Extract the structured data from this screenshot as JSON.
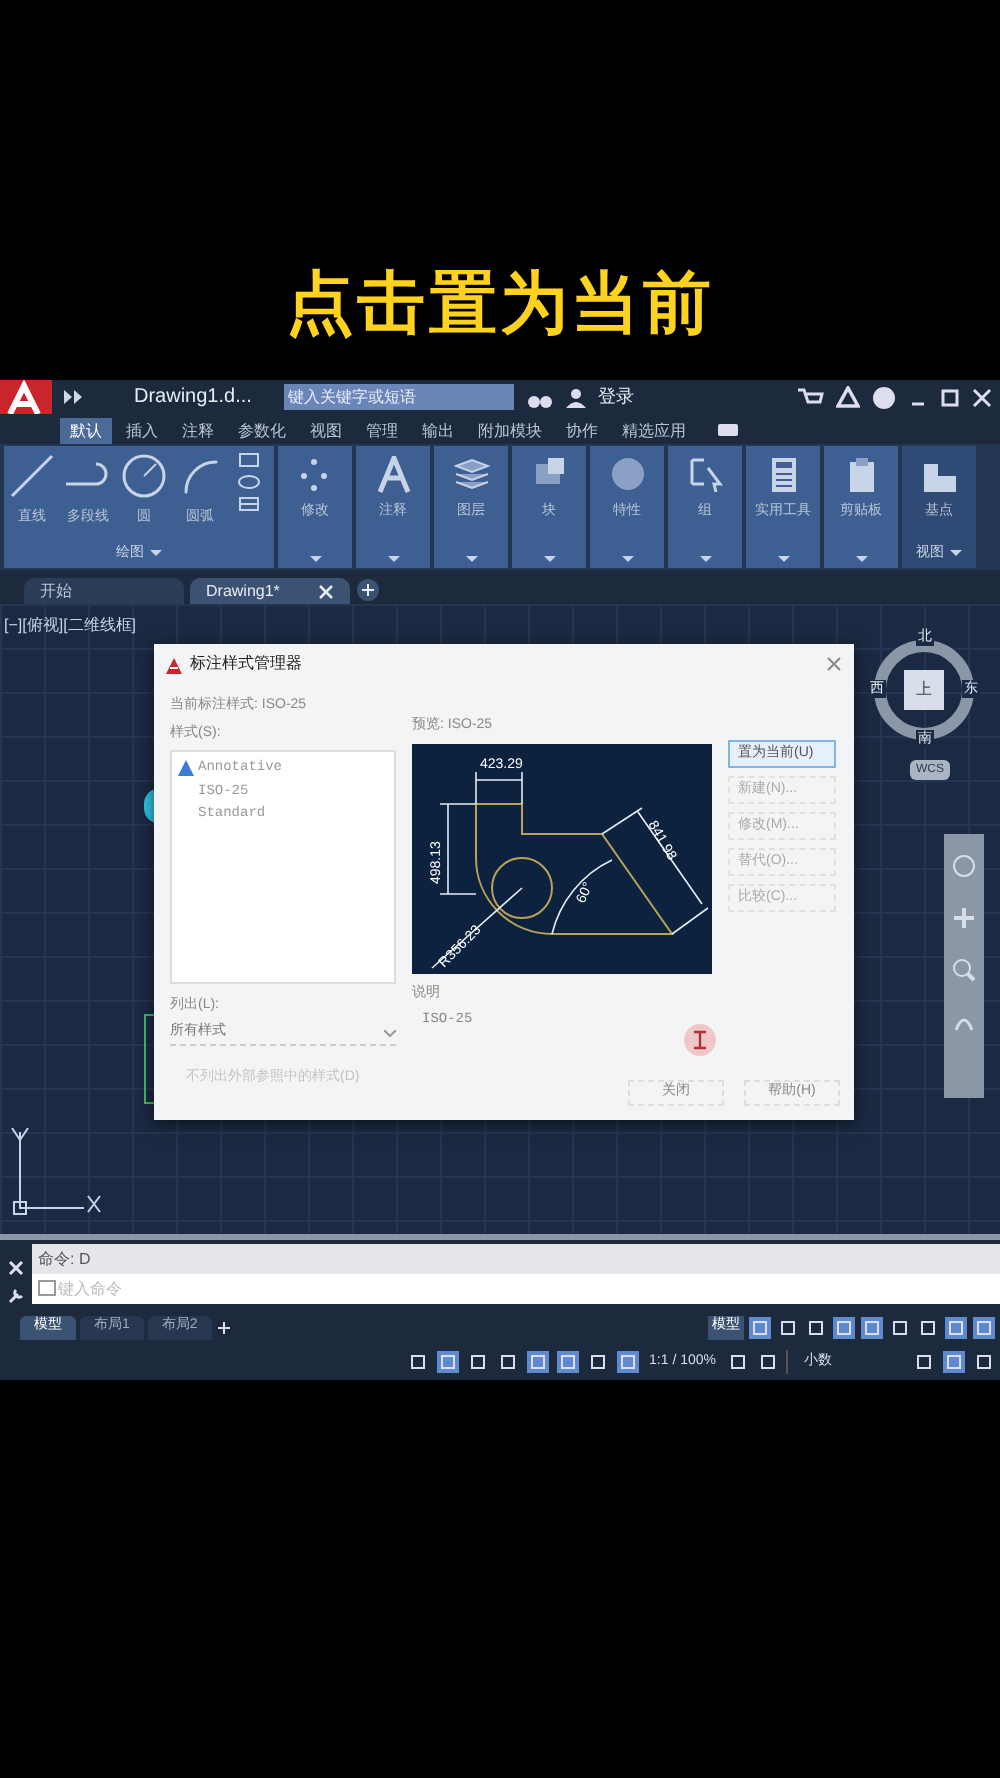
{
  "caption": "点击置为当前",
  "title_bar": {
    "file": "Drawing1.d...",
    "search_placeholder": "键入关键字或短语",
    "login": "登录"
  },
  "ribbon_tabs": [
    {
      "label": "默认",
      "selected": true
    },
    {
      "label": "插入",
      "selected": false
    },
    {
      "label": "注释",
      "selected": false
    },
    {
      "label": "参数化",
      "selected": false
    },
    {
      "label": "视图",
      "selected": false
    },
    {
      "label": "管理",
      "selected": false
    },
    {
      "label": "输出",
      "selected": false
    },
    {
      "label": "附加模块",
      "selected": false
    },
    {
      "label": "协作",
      "selected": false
    },
    {
      "label": "精选应用",
      "selected": false
    }
  ],
  "draw_panel": {
    "tools": [
      {
        "kind": "line",
        "label": "直线"
      },
      {
        "kind": "polyline",
        "label": "多段线"
      },
      {
        "kind": "circle",
        "label": "圆"
      },
      {
        "kind": "arc",
        "label": "圆弧"
      }
    ],
    "title": "绘图"
  },
  "panels": [
    {
      "kind": "move",
      "label": "修改"
    },
    {
      "kind": "text",
      "label": "注释"
    },
    {
      "kind": "layers",
      "label": "图层"
    },
    {
      "kind": "block",
      "label": "块"
    },
    {
      "kind": "props",
      "label": "特性"
    },
    {
      "kind": "group",
      "label": "组"
    },
    {
      "kind": "calc",
      "label": "实用工具"
    },
    {
      "kind": "clip",
      "label": "剪贴板"
    },
    {
      "kind": "base",
      "label": "基点",
      "title": "视图"
    }
  ],
  "doc_tabs": [
    {
      "label": "开始",
      "selected": false
    },
    {
      "label": "Drawing1*",
      "selected": true
    }
  ],
  "viewport_label": "[−][俯视][二维线框]",
  "viewcube": {
    "north": "北",
    "east": "东",
    "south": "南",
    "west": "西",
    "top": "上",
    "ucs": "WCS"
  },
  "dialog": {
    "title": "标注样式管理器",
    "current": "当前标注样式: ISO-25",
    "styles_label": "样式(S):",
    "styles": [
      {
        "label": "Annotative",
        "annotative": true
      },
      {
        "label": "ISO-25",
        "annotative": false
      },
      {
        "label": "Standard",
        "annotative": false
      }
    ],
    "preview_label": "预览: ISO-25",
    "dims": [
      "423.29",
      "498.13",
      "841.98",
      "60°",
      "R356.23"
    ],
    "list_label": "列出(L):",
    "list_value": "所有样式",
    "xref_option": {
      "label": "不列出外部参照中的样式(D)",
      "disabled": true
    },
    "description_label": "说明",
    "description": "ISO-25",
    "side_buttons": [
      {
        "label": "置为当前(U)",
        "selected": true
      },
      {
        "label": "新建(N)...",
        "selected": false
      },
      {
        "label": "修改(M)...",
        "selected": false
      },
      {
        "label": "替代(O)...",
        "selected": false
      },
      {
        "label": "比较(C)...",
        "selected": false
      }
    ],
    "bottom_buttons": [
      "关闭",
      "帮助(H)"
    ]
  },
  "command": {
    "history": "命令: D",
    "placeholder": "键入命令"
  },
  "layout_tabs": [
    {
      "label": "模型",
      "selected": true
    },
    {
      "label": "布局1",
      "selected": false
    },
    {
      "label": "布局2",
      "selected": false
    }
  ],
  "status": {
    "space": "模型",
    "scale": "1:1 / 100%",
    "units": "小数"
  }
}
